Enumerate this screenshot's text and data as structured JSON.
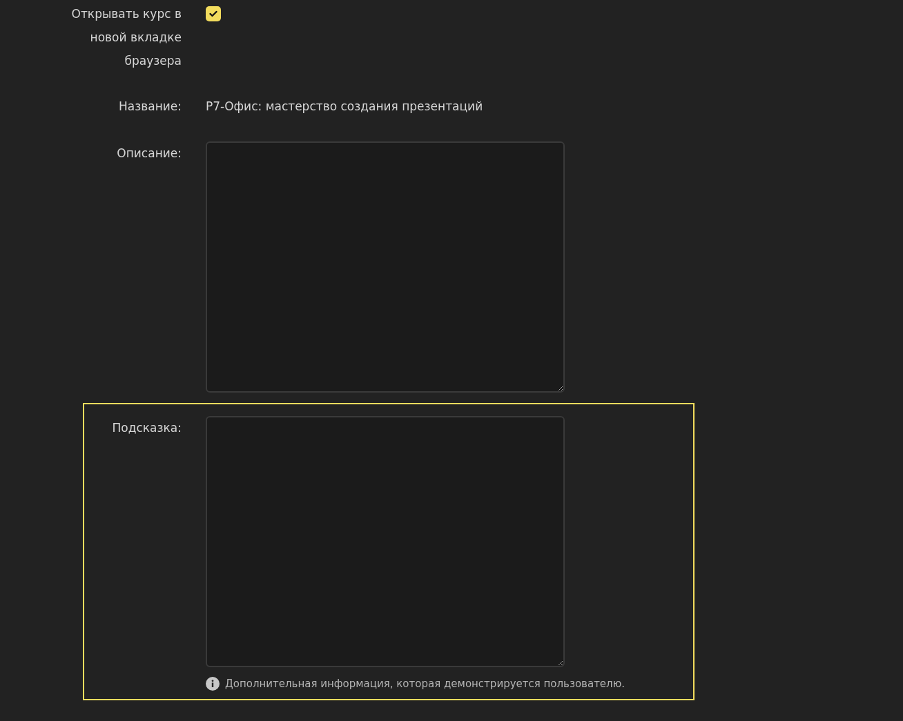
{
  "open_in_new_tab": {
    "label": "Открывать курс в новой вкладке браузера",
    "checked": true
  },
  "name": {
    "label": "Название:",
    "value": "Р7-Офис: мастерство создания презентаций"
  },
  "description": {
    "label": "Описание:"
  },
  "hint": {
    "label": "Подсказка:",
    "help": "Дополнительная информация, которая демонстрируется пользователю.",
    "highlighted": true
  }
}
